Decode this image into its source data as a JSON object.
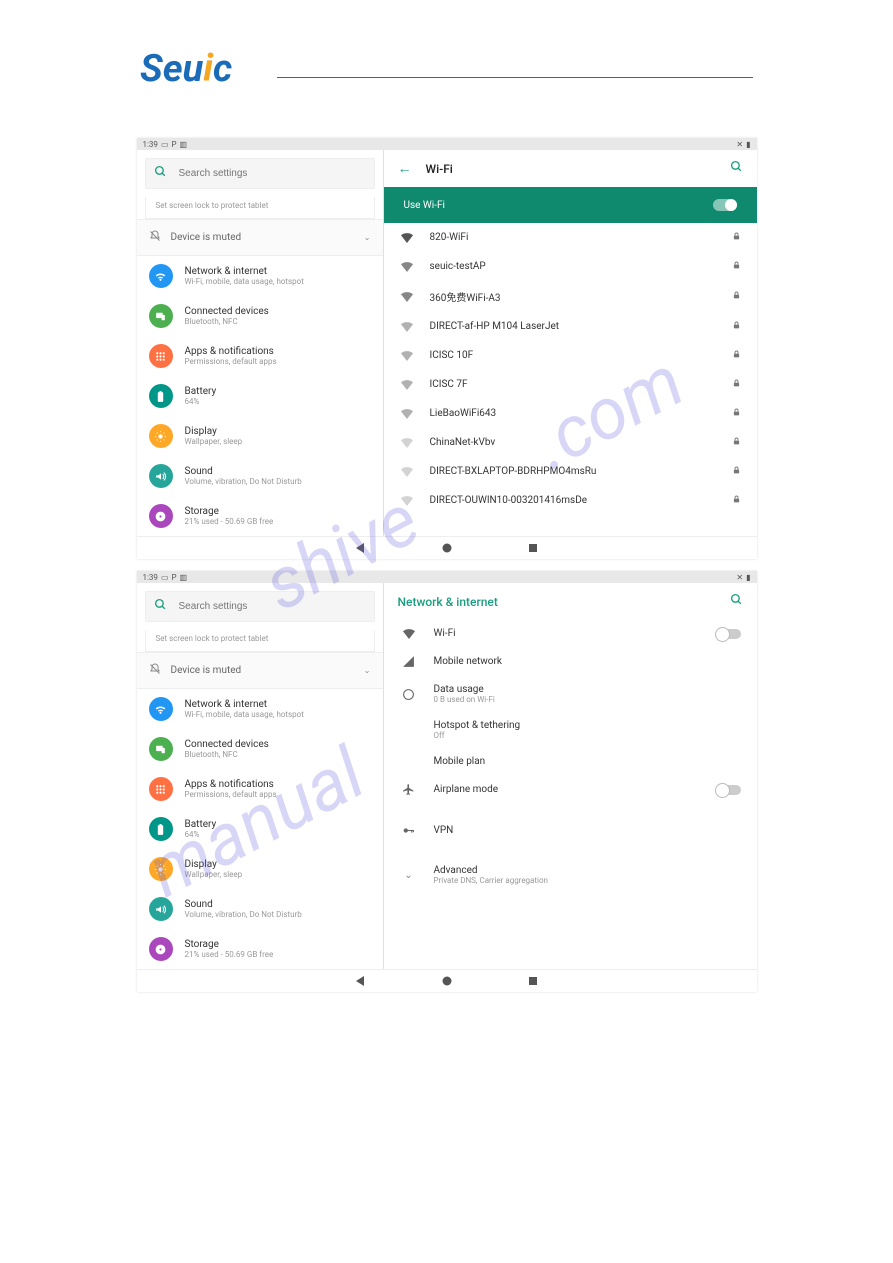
{
  "logo_text": "Seuic",
  "statusbar": {
    "time": "1:39"
  },
  "search": {
    "placeholder": "Search settings"
  },
  "hint": "Set screen lock to protect tablet",
  "muted_label": "Device is muted",
  "settings": [
    {
      "title": "Network & internet",
      "subtitle": "Wi-Fi, mobile, data usage, hotspot",
      "color": "#2196f3",
      "icon": "wifi"
    },
    {
      "title": "Connected devices",
      "subtitle": "Bluetooth, NFC",
      "color": "#4caf50",
      "icon": "devices"
    },
    {
      "title": "Apps & notifications",
      "subtitle": "Permissions, default apps",
      "color": "#ff7043",
      "icon": "apps"
    },
    {
      "title": "Battery",
      "subtitle": "64%",
      "color": "#009688",
      "icon": "battery"
    },
    {
      "title": "Display",
      "subtitle": "Wallpaper, sleep",
      "color": "#ffa726",
      "icon": "display"
    },
    {
      "title": "Sound",
      "subtitle": "Volume, vibration, Do Not Disturb",
      "color": "#26a69a",
      "icon": "sound"
    },
    {
      "title": "Storage",
      "subtitle": "21% used - 50.69 GB free",
      "color": "#ab47bc",
      "icon": "storage"
    }
  ],
  "wifi_panel": {
    "title": "Wi-Fi",
    "use_wifi": "Use Wi-Fi",
    "networks": [
      {
        "name": "820-WiFi",
        "strength": 4,
        "locked": true
      },
      {
        "name": "seuic-testAP",
        "strength": 3,
        "locked": true
      },
      {
        "name": "360免费WiFi-A3",
        "strength": 3,
        "locked": true
      },
      {
        "name": "DIRECT-af-HP M104 LaserJet",
        "strength": 2,
        "locked": true
      },
      {
        "name": "ICISC 10F",
        "strength": 2,
        "locked": true
      },
      {
        "name": "ICISC 7F",
        "strength": 2,
        "locked": true
      },
      {
        "name": "LieBaoWiFi643",
        "strength": 2,
        "locked": true
      },
      {
        "name": "ChinaNet-kVbv",
        "strength": 1,
        "locked": true
      },
      {
        "name": "DIRECT-BXLAPTOP-BDRHPMO4msRu",
        "strength": 1,
        "locked": true
      },
      {
        "name": "DIRECT-OUWIN10-003201416msDe",
        "strength": 1,
        "locked": true
      }
    ]
  },
  "network_panel": {
    "title": "Network & internet",
    "items": [
      {
        "title": "Wi-Fi",
        "subtitle": "",
        "icon": "wifi",
        "toggle": "off"
      },
      {
        "title": "Mobile network",
        "subtitle": "",
        "icon": "cell"
      },
      {
        "title": "Data usage",
        "subtitle": "0 B used on Wi-Fi",
        "icon": "data"
      },
      {
        "title": "Hotspot & tethering",
        "subtitle": "Off",
        "icon": "hotspot"
      },
      {
        "title": "Mobile plan",
        "subtitle": "",
        "icon": "none"
      },
      {
        "title": "Airplane mode",
        "subtitle": "",
        "icon": "airplane",
        "toggle": "off"
      },
      {
        "title": "VPN",
        "subtitle": "",
        "icon": "vpn"
      },
      {
        "title": "Advanced",
        "subtitle": "Private DNS, Carrier aggregation",
        "icon": "expand"
      }
    ]
  },
  "watermark": "manualshive.com"
}
